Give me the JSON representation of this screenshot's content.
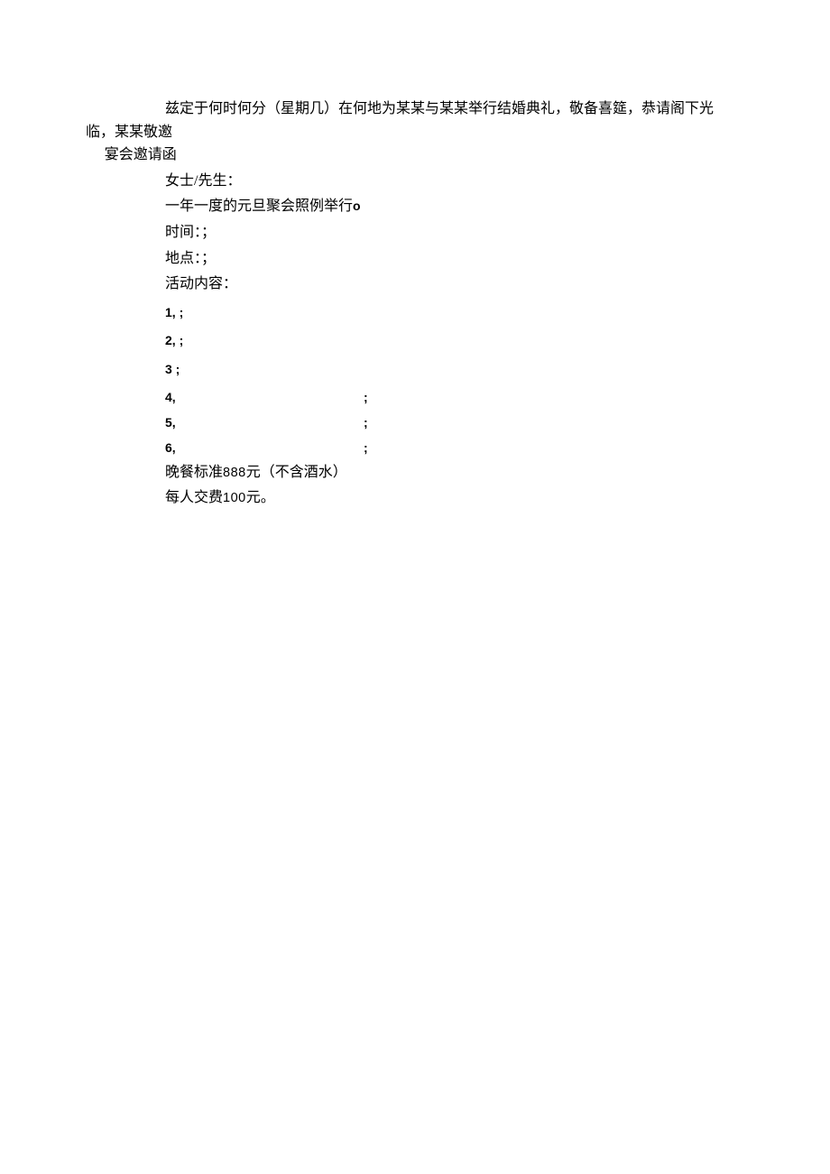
{
  "wedding": {
    "line1": "兹定于何时何分（星期几）在何地为某某与某某举行结婚典礼，敬备喜筵，恭请阁下光",
    "line2": "临，某某敬邀"
  },
  "invite": {
    "title": "宴会邀请函",
    "salutation": "女士/先生：",
    "intro_prefix": "一年一度的元旦聚会照例举行",
    "intro_suffix": "o",
    "time_label": "时间：；",
    "place_label": "地点：；",
    "activity_label": "活动内容：",
    "items": [
      {
        "num": "1, ;",
        "wide": false
      },
      {
        "num": "2, ;",
        "wide": false
      },
      {
        "num": "3 ;",
        "wide": false
      },
      {
        "num": "4,",
        "wide": true,
        "tail": ";"
      },
      {
        "num": "5,",
        "wide": true,
        "tail": ";"
      },
      {
        "num": "6,",
        "wide": true,
        "tail": ";"
      }
    ],
    "dinner_prefix": "晚餐标准",
    "dinner_amount": "888",
    "dinner_suffix": "元（不含酒水）",
    "fee_prefix": "每人交费",
    "fee_amount": "100",
    "fee_suffix": "元。"
  }
}
